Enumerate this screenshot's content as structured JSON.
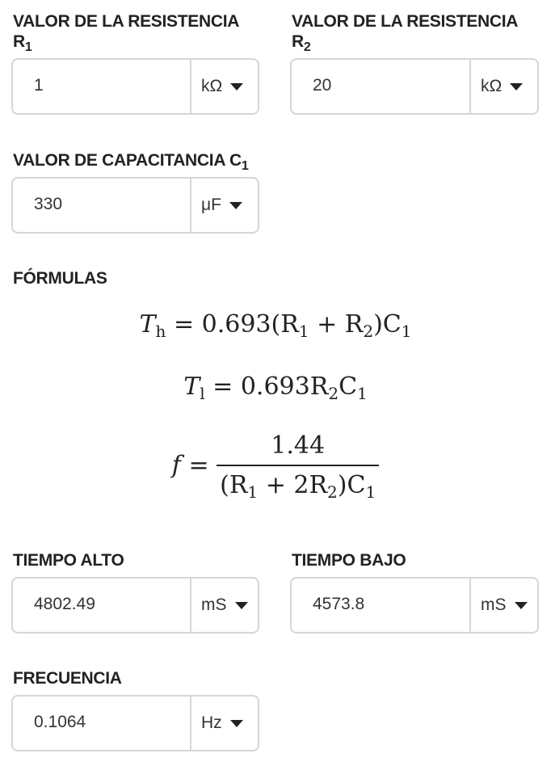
{
  "r1": {
    "label": "VALOR DE LA RESISTENCIA R",
    "label_sub": "1",
    "value": "1",
    "unit": "kΩ"
  },
  "r2": {
    "label": "VALOR DE LA RESISTENCIA R",
    "label_sub": "2",
    "value": "20",
    "unit": "kΩ"
  },
  "c1": {
    "label": "VALOR DE CAPACITANCIA C",
    "label_sub": "1",
    "value": "330",
    "unit": "μF"
  },
  "formulas": {
    "title": "FÓRMULAS",
    "th": {
      "lhs": "T",
      "lhs_sub": "h",
      "rhs": " = 0.693(R",
      "s1": "1",
      "mid": " + R",
      "s2": "2",
      "end": ")C",
      "s3": "1"
    },
    "tl": {
      "lhs": "T",
      "lhs_sub": "l",
      "rhs": " = 0.693R",
      "s1": "2",
      "mid": "C",
      "s2": "1"
    },
    "f": {
      "lhs": "f",
      "eq": " = ",
      "num": "1.44",
      "den_a": "(R",
      "s1": "1",
      "den_b": " + 2R",
      "s2": "2",
      "den_c": ")C",
      "s3": "1"
    }
  },
  "t_high": {
    "label": "TIEMPO ALTO",
    "value": "4802.49",
    "unit": "mS"
  },
  "t_low": {
    "label": "TIEMPO BAJO",
    "value": "4573.8",
    "unit": "mS"
  },
  "freq": {
    "label": "FRECUENCIA",
    "value": "0.1064",
    "unit": "Hz"
  },
  "icons": {
    "dropdown": "caret-down-icon"
  }
}
